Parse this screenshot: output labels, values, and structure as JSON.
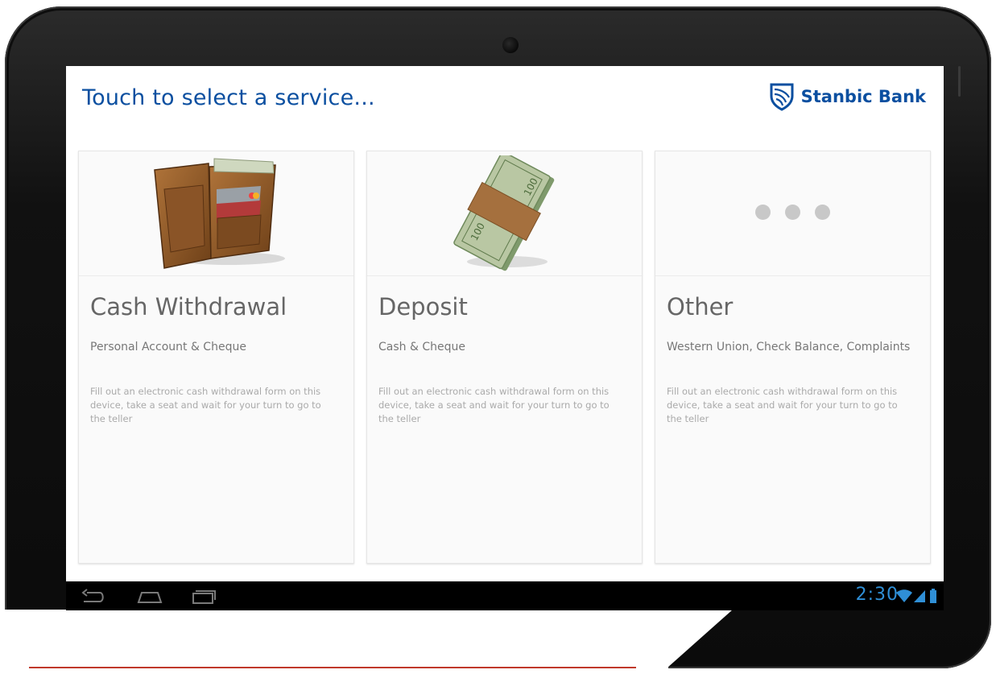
{
  "header": {
    "title": "Touch to select a service...",
    "brand": "Stanbic Bank"
  },
  "services": [
    {
      "title": "Cash Withdrawal",
      "subtitle": "Personal Account & Cheque",
      "description": "Fill out an electronic cash withdrawal form on this device, take a seat and wait for your turn to go to the teller",
      "icon": "wallet-icon"
    },
    {
      "title": "Deposit",
      "subtitle": "Cash & Cheque",
      "description": "Fill out an electronic cash withdrawal form on this device, take a seat and wait for your turn to go to the teller",
      "icon": "cash-stack-icon"
    },
    {
      "title": "Other",
      "subtitle": "Western Union, Check Balance, Complaints",
      "description": "Fill out an electronic cash withdrawal form on this device, take a seat and wait for your turn to go to the teller",
      "icon": "more-dots-icon"
    }
  ],
  "system_bar": {
    "time": "2:30",
    "nav_icons": [
      "back-icon",
      "home-icon",
      "recent-apps-icon"
    ],
    "status_icons": [
      "wifi-icon",
      "signal-icon",
      "battery-icon"
    ]
  },
  "colors": {
    "brand_blue": "#0b4fa0",
    "clock_blue": "#2f8fd6"
  }
}
